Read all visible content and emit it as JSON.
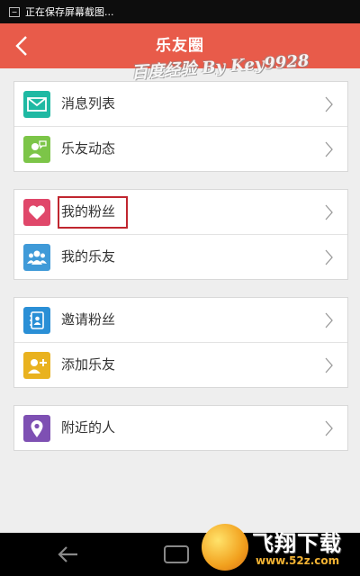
{
  "status_bar": {
    "text": "正在保存屏幕截图..."
  },
  "header": {
    "title": "乐友圈"
  },
  "watermark": "百度经验 By Key9928",
  "groups": [
    {
      "items": [
        {
          "label": "消息列表",
          "icon": "envelope-icon",
          "color": "#1fb9a3"
        },
        {
          "label": "乐友动态",
          "icon": "user-feed-icon",
          "color": "#7cc548"
        }
      ]
    },
    {
      "items": [
        {
          "label": "我的粉丝",
          "icon": "heart-icon",
          "color": "#e0476a"
        },
        {
          "label": "我的乐友",
          "icon": "friends-icon",
          "color": "#3f9ad8"
        }
      ]
    },
    {
      "items": [
        {
          "label": "邀请粉丝",
          "icon": "contact-book-icon",
          "color": "#2a8fd6"
        },
        {
          "label": "添加乐友",
          "icon": "add-friend-icon",
          "color": "#e9b21f"
        }
      ]
    },
    {
      "items": [
        {
          "label": "附近的人",
          "icon": "location-pin-icon",
          "color": "#7e50b3"
        }
      ]
    }
  ],
  "logo": {
    "text": "飞翔下载",
    "url": "www.52z.com"
  }
}
